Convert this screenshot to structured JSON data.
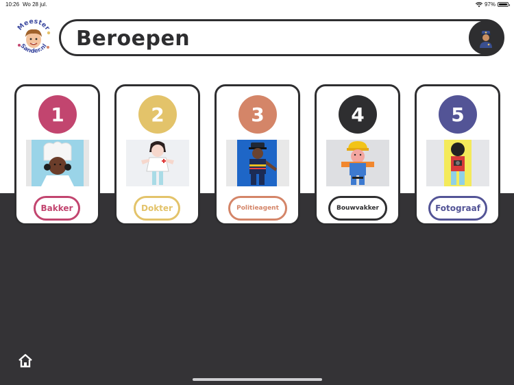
{
  "status_bar": {
    "time": "10:26",
    "date": "Wo 28 jul.",
    "battery": "97%",
    "battery_fill": 0.97
  },
  "logo": {
    "line1": "Meester",
    "line2": "Sander.nl"
  },
  "header": {
    "title": "Beroepen",
    "avatar_icon": "police-officer-icon"
  },
  "cards": [
    {
      "number": "1",
      "label": "Bakker",
      "color": "#c2456f",
      "image": "baker-craft-image"
    },
    {
      "number": "2",
      "label": "Dokter",
      "color": "#e3c36a",
      "image": "doctor-craft-image"
    },
    {
      "number": "3",
      "label": "Politieagent",
      "color": "#d48568",
      "image": "police-craft-image"
    },
    {
      "number": "4",
      "label": "Bouwvakker",
      "color": "#2e2e30",
      "image": "builder-craft-image"
    },
    {
      "number": "5",
      "label": "Fotograaf",
      "color": "#535496",
      "image": "photographer-craft-image"
    }
  ],
  "footer": {
    "home_icon": "home-icon"
  }
}
